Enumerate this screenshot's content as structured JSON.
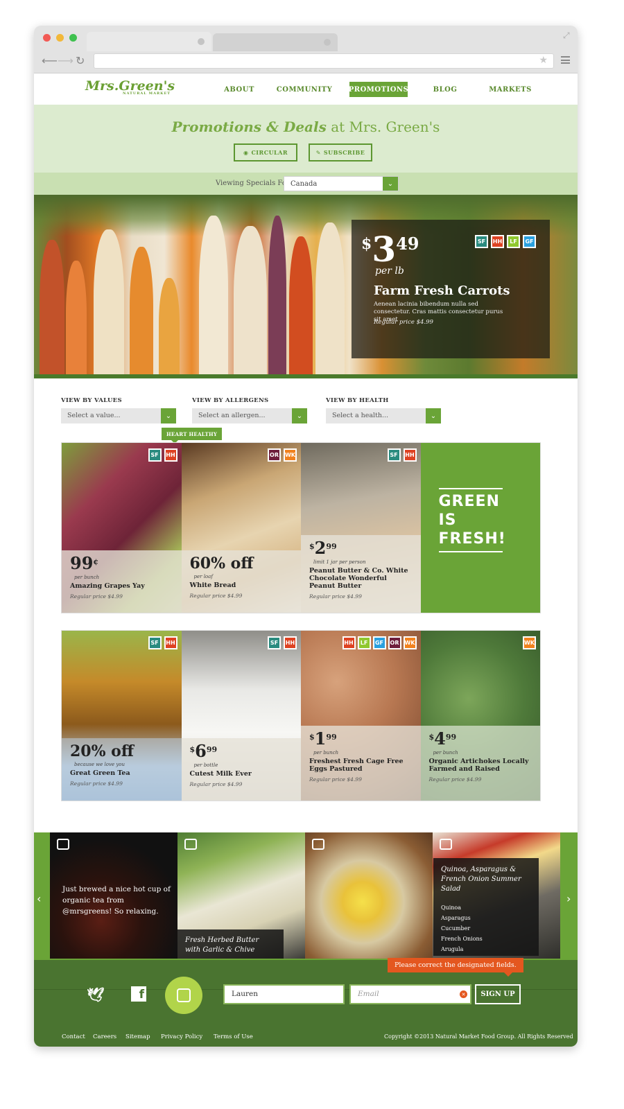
{
  "nav": {
    "logo": "Mrs.Green's",
    "logo_sub": "NATURAL MARKET",
    "items": [
      "ABOUT",
      "COMMUNITY",
      "PROMOTIONS",
      "BLOG",
      "MARKETS"
    ],
    "active": "PROMOTIONS"
  },
  "promo": {
    "title_script": "Promotions & Deals",
    "title_plain": "at Mrs. Green's",
    "btn_circular": "CIRCULAR",
    "btn_subscribe": "SUBSCRIBE"
  },
  "viewing": {
    "label": "Viewing Specials For",
    "value": "Canada"
  },
  "hero": {
    "currency": "$",
    "price_int": "3",
    "price_dec": "49",
    "unit": "per lb",
    "name": "Farm Fresh Carrots",
    "desc": "Aenean lacinia bibendum nulla sed consectetur. Cras mattis consectetur purus sit amet",
    "regular": "Regular price $4.99",
    "badges": [
      "SF",
      "HH",
      "LF",
      "GF"
    ]
  },
  "filters": {
    "values_label": "VIEW BY VALUES",
    "values_ph": "Select a value...",
    "allergens_label": "VIEW BY ALLERGENS",
    "allergens_ph": "Select an allergen...",
    "health_label": "VIEW BY HEALTH",
    "health_ph": "Select a health...",
    "tooltip": "HEART HEALTHY"
  },
  "row1": [
    {
      "price": "99",
      "cents_sign": "¢",
      "unit": "per bunch",
      "name": "Amazing Grapes Yay",
      "regular": "Regular price $4.99",
      "badges": [
        "SF",
        "HH"
      ]
    },
    {
      "off": "60% off",
      "unit": "per loaf",
      "name": "White Bread",
      "regular": "Regular price $4.99",
      "badges": [
        "OR",
        "WK"
      ]
    },
    {
      "currency": "$",
      "price": "2",
      "dec": "99",
      "unit": "limit 1 jar per person",
      "name": "Peanut Butter & Co. White Chocolate Wonderful Peanut Butter",
      "regular": "Regular price $4.99",
      "badges": [
        "SF",
        "HH"
      ]
    },
    {
      "green": "GREEN IS FRESH!"
    }
  ],
  "row2": [
    {
      "off": "20% off",
      "unit": "because we love you",
      "name": "Great Green Tea",
      "regular": "Regular price $4.99",
      "badges": [
        "SF",
        "HH"
      ]
    },
    {
      "currency": "$",
      "price": "6",
      "dec": "99",
      "unit": "per bottle",
      "name": "Cutest Milk Ever",
      "regular": "Regular price $4.99",
      "badges": [
        "SF",
        "HH"
      ]
    },
    {
      "currency": "$",
      "price": "1",
      "dec": "99",
      "unit": "per bunch",
      "name": "Freshest Fresh Cage Free Eggs Pastured",
      "regular": "Regular price $4.99",
      "badges": [
        "HH",
        "LF",
        "GF",
        "OR",
        "WK"
      ]
    },
    {
      "currency": "$",
      "price": "4",
      "dec": "99",
      "unit": "per bunch",
      "name": "Organic Artichokes Locally Farmed and Raised",
      "regular": "Regular price $4.99",
      "badges": [
        "WK"
      ]
    }
  ],
  "social": {
    "tea_post": "Just brewed a nice hot cup of organic tea from @mrsgreens! So relaxing.",
    "butter_caption": "Fresh Herbed Butter with Garlic & Chive",
    "quinoa_title": "Quinoa, Asparagus & French Onion Summer Salad",
    "quinoa_items": [
      "Quinoa",
      "Asparagus",
      "Cucumber",
      "French Onions",
      "Arugula"
    ]
  },
  "signup": {
    "error": "Please correct the designated fields.",
    "name_value": "Lauren",
    "email_ph": "Email",
    "button": "SIGN UP"
  },
  "footer": {
    "links": [
      "Contact",
      "Careers",
      "Sitemap",
      "Privacy Policy",
      "Terms of Use"
    ],
    "copyright": "Copyright ©2013 Natural Market Food Group. All Rights Reserved"
  },
  "colors": {
    "brand_green": "#6aa437",
    "dark_green": "#4a7430",
    "light_green": "#dcebcf",
    "error": "#e4571f"
  }
}
